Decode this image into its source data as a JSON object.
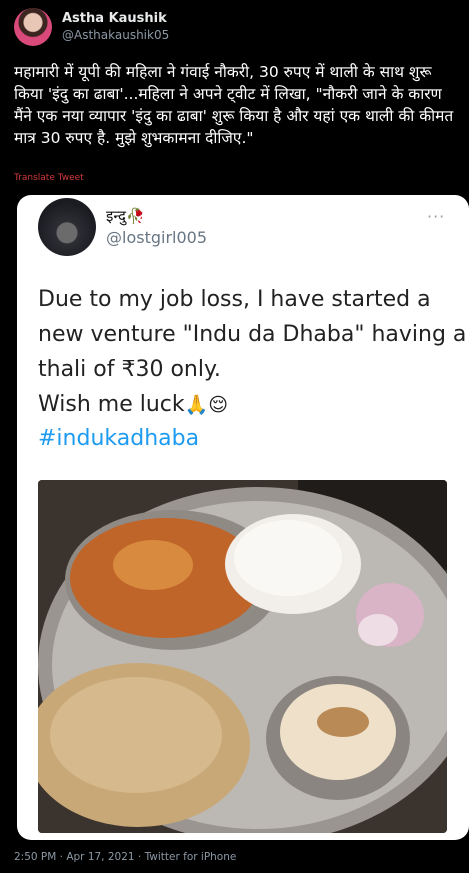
{
  "tweet": {
    "author_name": "Astha Kaushik",
    "author_handle": "@Asthakaushik05",
    "text": "महामारी में यूपी की महिला ने गंवाई नौकरी, 30 रुपए में थाली के साथ शुरू किया 'इंदु का ढाबा'...महिला ने अपने ट्वीट में लिखा, \"नौकरी जाने के कारण मैंने एक नया व्यापार 'इंदु का ढाबा' शुरू किया है और यहां एक थाली की कीमत मात्र 30 रुपए है. मुझे शुभकामना दीजिए.\"",
    "translate_label": "Translate Tweet",
    "footer": "2:50 PM · Apr 17, 2021 · Twitter for iPhone"
  },
  "embedded": {
    "author_name": "इन्दु",
    "author_name_emoji": "🥀",
    "author_handle": "@lostgirl005",
    "more_label": "···",
    "lines": [
      "Due to my job loss, I have started a",
      "new venture \"Indu da Dhaba\" having a",
      "thali of ₹30 only.",
      "Wish me luck"
    ],
    "luck_emojis": "🙏😌",
    "hashtag": "#indukadhaba"
  },
  "icons": {
    "avatar": "profile-photo",
    "inner_avatar": "silhouette-photo",
    "photo": "thali-food-photo"
  }
}
